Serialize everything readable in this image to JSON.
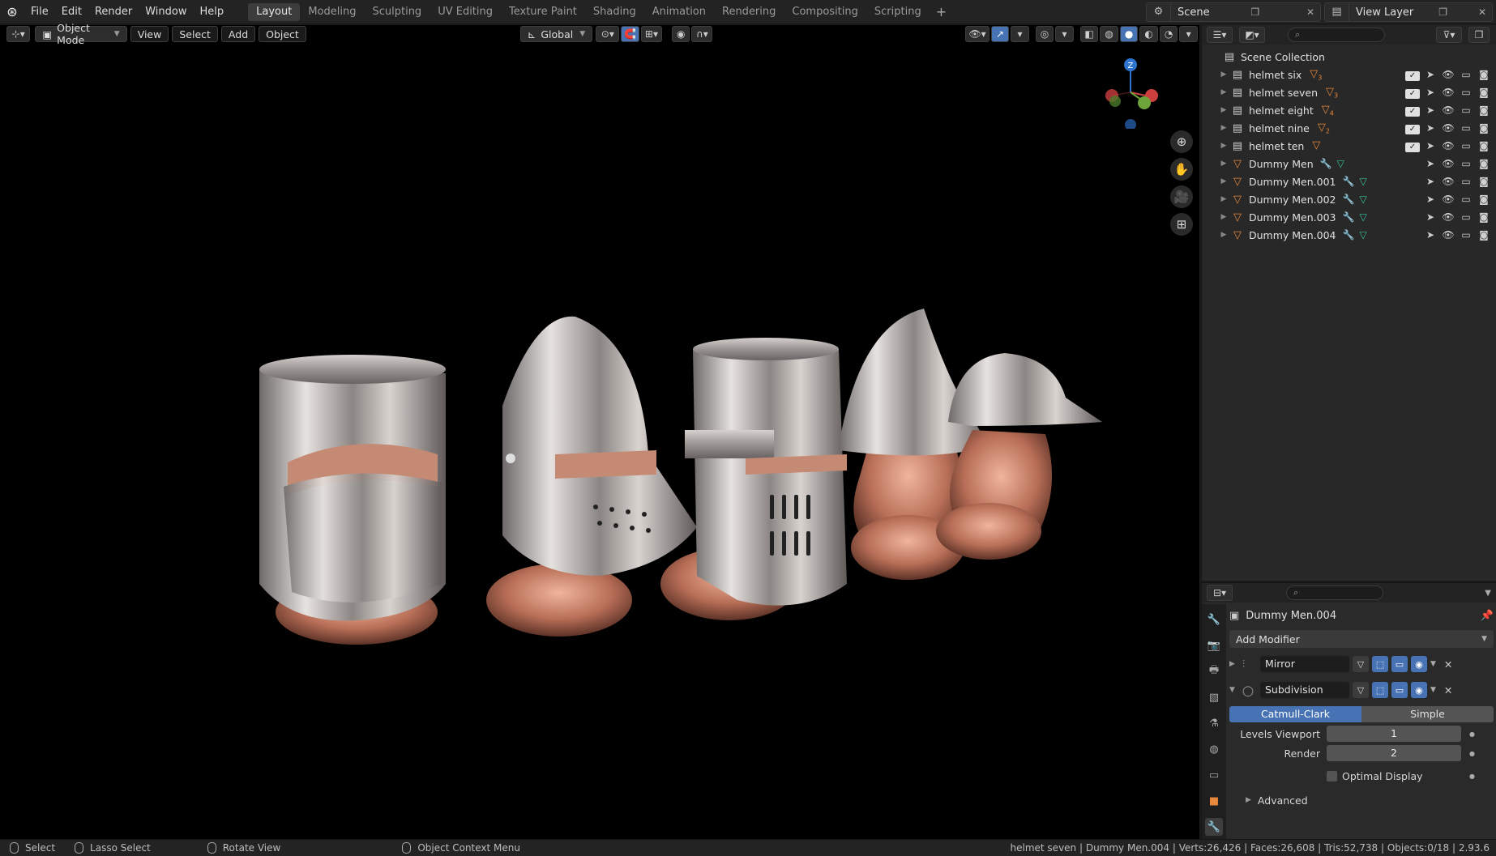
{
  "menu": [
    "File",
    "Edit",
    "Render",
    "Window",
    "Help"
  ],
  "workspaces": [
    "Layout",
    "Modeling",
    "Sculpting",
    "UV Editing",
    "Texture Paint",
    "Shading",
    "Animation",
    "Rendering",
    "Compositing",
    "Scripting"
  ],
  "active_workspace": "Layout",
  "scene": "Scene",
  "view_layer": "View Layer",
  "viewport": {
    "mode": "Object Mode",
    "menus": [
      "View",
      "Select",
      "Add",
      "Object"
    ],
    "transform_orientation": "Global"
  },
  "outliner": {
    "root": "Scene Collection",
    "rows": [
      {
        "name": "helmet six",
        "badge": "3"
      },
      {
        "name": "helmet seven",
        "badge": "3"
      },
      {
        "name": "helmet eight",
        "badge": "4"
      },
      {
        "name": "helmet nine",
        "badge": "2"
      },
      {
        "name": "helmet ten",
        "badge": ""
      },
      {
        "name": "Dummy Men",
        "badge": ""
      },
      {
        "name": "Dummy Men.001",
        "badge": ""
      },
      {
        "name": "Dummy Men.002",
        "badge": ""
      },
      {
        "name": "Dummy Men.003",
        "badge": ""
      },
      {
        "name": "Dummy Men.004",
        "badge": ""
      }
    ]
  },
  "properties": {
    "object": "Dummy Men.004",
    "add_modifier": "Add Modifier",
    "modifiers": [
      "Mirror",
      "Subdivision"
    ],
    "subdiv_types": [
      "Catmull-Clark",
      "Simple"
    ],
    "levels_viewport_label": "Levels Viewport",
    "levels_viewport": "1",
    "render_label": "Render",
    "render": "2",
    "optimal_display": "Optimal Display",
    "advanced": "Advanced"
  },
  "status": {
    "select": "Select",
    "lasso": "Lasso Select",
    "rotate": "Rotate View",
    "context": "Object Context Menu",
    "stats": "helmet seven | Dummy Men.004 | Verts:26,426 | Faces:26,608 | Tris:52,738 | Objects:0/18 | 2.93.6"
  },
  "colors": {
    "accent": "#4772b3",
    "object_icon": "#e8883b",
    "mesh_icon": "#36c09a"
  }
}
